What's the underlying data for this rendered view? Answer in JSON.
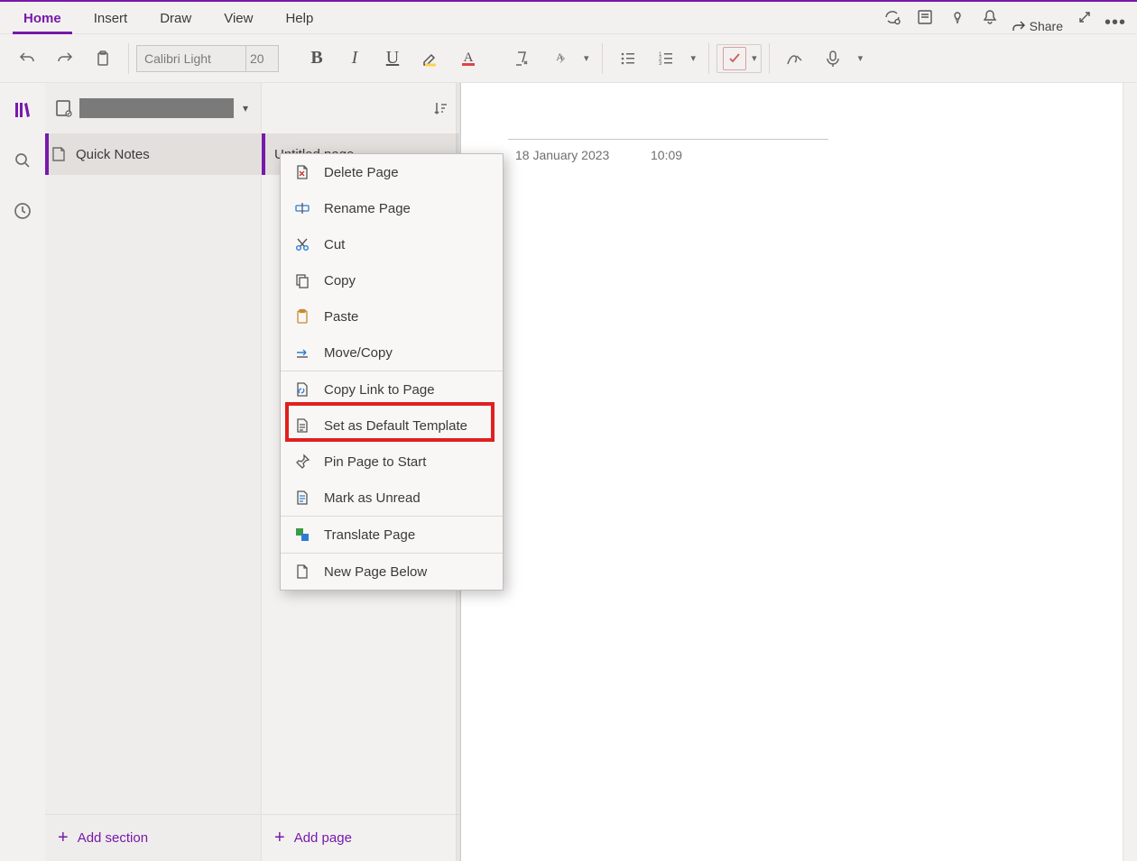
{
  "ribbon": {
    "tabs": [
      "Home",
      "Insert",
      "Draw",
      "View",
      "Help"
    ],
    "share_label": "Share"
  },
  "toolbar": {
    "font_name": "Calibri Light",
    "font_size": "20"
  },
  "navigation": {
    "section_label": "Quick Notes",
    "page_label": "Untitled page",
    "add_section_label": "Add section",
    "add_page_label": "Add page"
  },
  "page": {
    "date": "18 January 2023",
    "time": "10:09"
  },
  "context_menu": {
    "items": [
      "Delete Page",
      "Rename Page",
      "Cut",
      "Copy",
      "Paste",
      "Move/Copy",
      "Copy Link to Page",
      "Set as Default Template",
      "Pin Page to Start",
      "Mark as Unread",
      "Translate Page",
      "New Page Below"
    ],
    "highlighted_index": 7
  }
}
